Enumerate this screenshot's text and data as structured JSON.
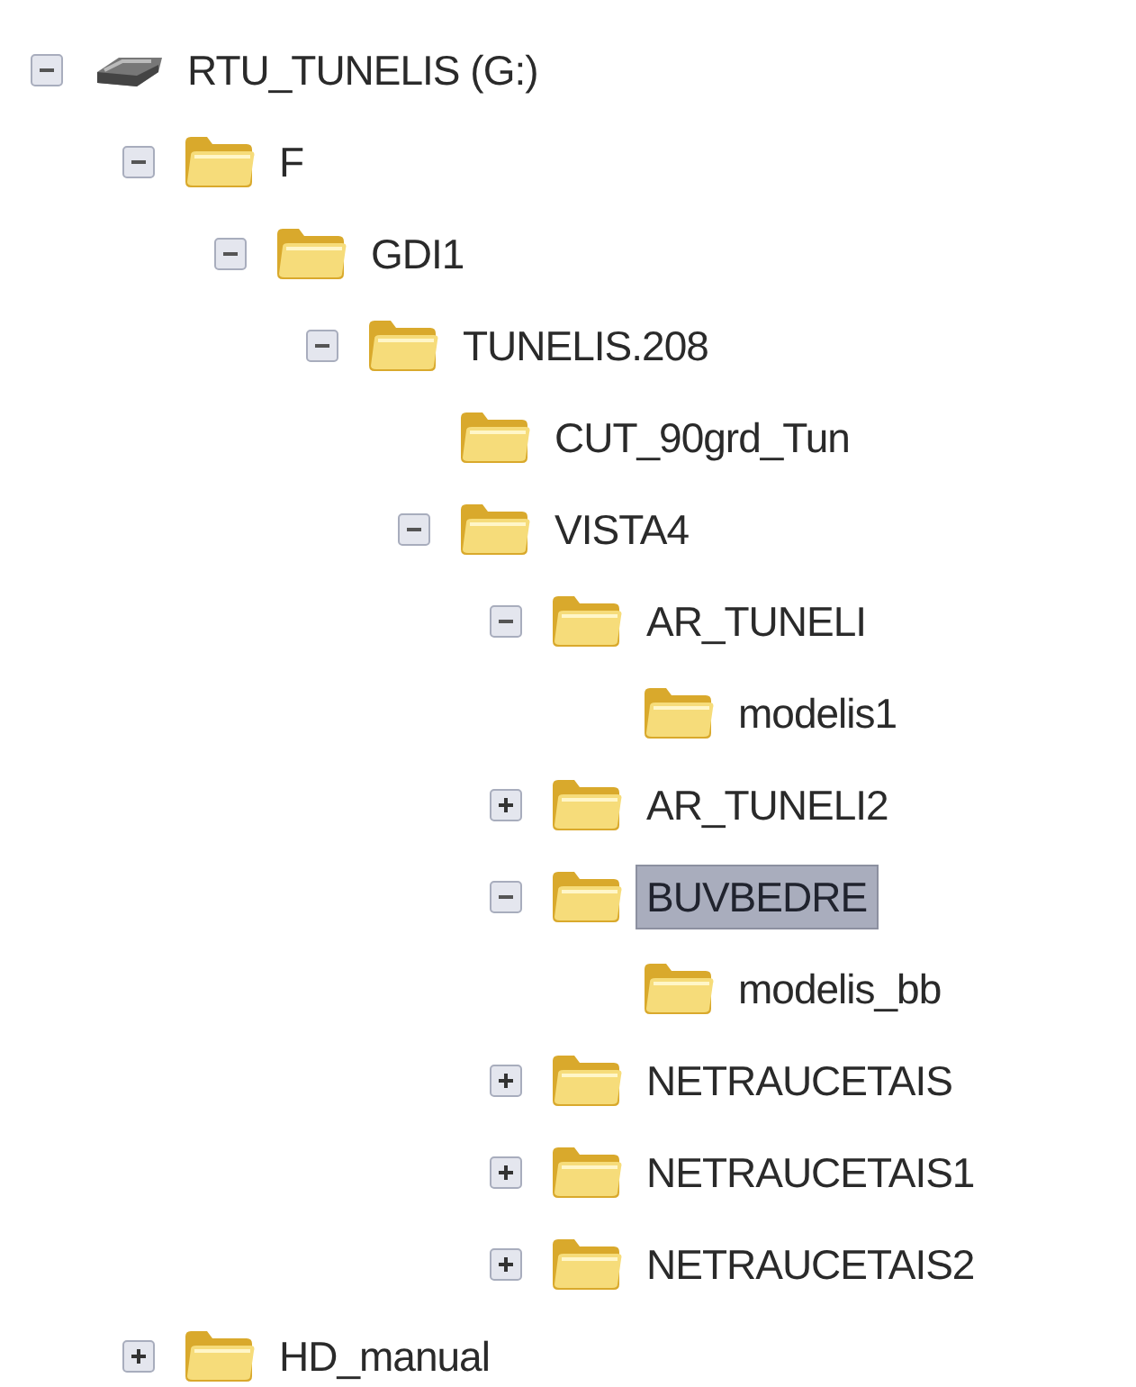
{
  "tree": [
    {
      "label": "RTU_TUNELIS (G:)",
      "kind": "drive",
      "expanded": true,
      "selected": false,
      "children": [
        {
          "label": "F",
          "kind": "folder",
          "expanded": true,
          "selected": false,
          "children": [
            {
              "label": "GDI1",
              "kind": "folder",
              "expanded": true,
              "selected": false,
              "children": [
                {
                  "label": "TUNELIS.208",
                  "kind": "folder",
                  "expanded": true,
                  "selected": false,
                  "children": [
                    {
                      "label": "CUT_90grd_Tun",
                      "kind": "folder",
                      "selected": false
                    },
                    {
                      "label": "VISTA4",
                      "kind": "folder",
                      "expanded": true,
                      "selected": false,
                      "children": [
                        {
                          "label": "AR_TUNELI",
                          "kind": "folder",
                          "expanded": true,
                          "selected": false,
                          "children": [
                            {
                              "label": "modelis1",
                              "kind": "folder",
                              "selected": false
                            }
                          ]
                        },
                        {
                          "label": "AR_TUNELI2",
                          "kind": "folder",
                          "expanded": false,
                          "selected": false
                        },
                        {
                          "label": "BUVBEDRE",
                          "kind": "folder",
                          "expanded": true,
                          "selected": true,
                          "children": [
                            {
                              "label": "modelis_bb",
                              "kind": "folder",
                              "selected": false
                            }
                          ]
                        },
                        {
                          "label": "NETRAUCETAIS",
                          "kind": "folder",
                          "expanded": false,
                          "selected": false
                        },
                        {
                          "label": "NETRAUCETAIS1",
                          "kind": "folder",
                          "expanded": false,
                          "selected": false
                        },
                        {
                          "label": "NETRAUCETAIS2",
                          "kind": "folder",
                          "expanded": false,
                          "selected": false
                        }
                      ]
                    }
                  ]
                }
              ]
            }
          ]
        },
        {
          "label": "HD_manual",
          "kind": "folder",
          "expanded": false,
          "selected": false
        }
      ]
    }
  ]
}
